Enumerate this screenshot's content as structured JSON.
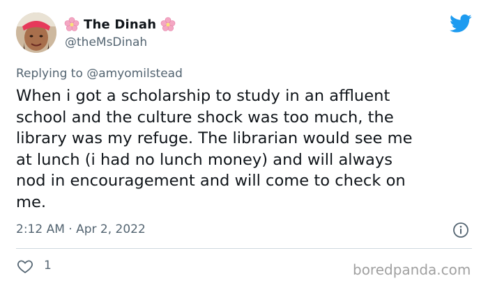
{
  "author": {
    "display_name": "The Dinah",
    "handle": "@theMsDinah",
    "avatar_icon": "avatar-photo"
  },
  "reply": {
    "text": "Replying to @amyomilstead"
  },
  "tweet": {
    "text": "When i got a scholarship to study in an affluent\nschool and the culture shock was too much, the\nlibrary was my refuge. The librarian would see me\nat lunch (i had no lunch money) and will always\nnod in encouragement and will come to check on\nme.",
    "timestamp": "2:12 AM · Apr 2, 2022",
    "likes": "1"
  },
  "watermark": "boredpanda.com",
  "colors": {
    "twitter_blue": "#1d9bf0",
    "secondary_text": "#536471",
    "flower_pink": "#f4a7c3"
  },
  "icons": {
    "brand": "twitter-bird-icon",
    "decoration": "cherry-blossom-icon",
    "info": "info-icon",
    "like": "heart-icon"
  }
}
